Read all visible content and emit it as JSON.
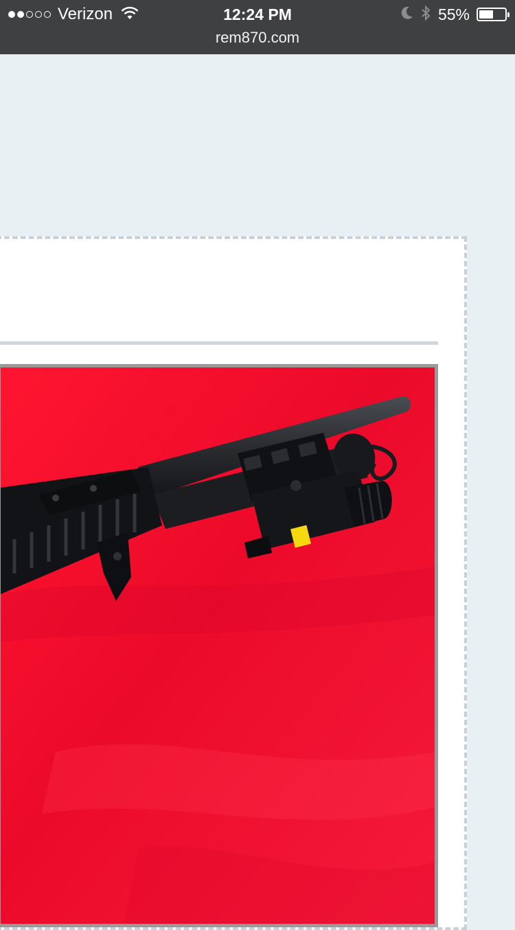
{
  "status_bar": {
    "signal_dots_filled": 2,
    "signal_dots_total": 5,
    "carrier": "Verizon",
    "time": "12:24 PM",
    "battery_percent": "55%",
    "battery_level": 0.55,
    "icons": [
      "wifi-icon",
      "moon-icon",
      "bluetooth-icon",
      "battery-icon"
    ]
  },
  "browser": {
    "url": "rem870.com"
  },
  "colors": {
    "page_background": "#e9f0f3",
    "status_bar": "#3f4042",
    "photo_background": "#f20d2f"
  }
}
